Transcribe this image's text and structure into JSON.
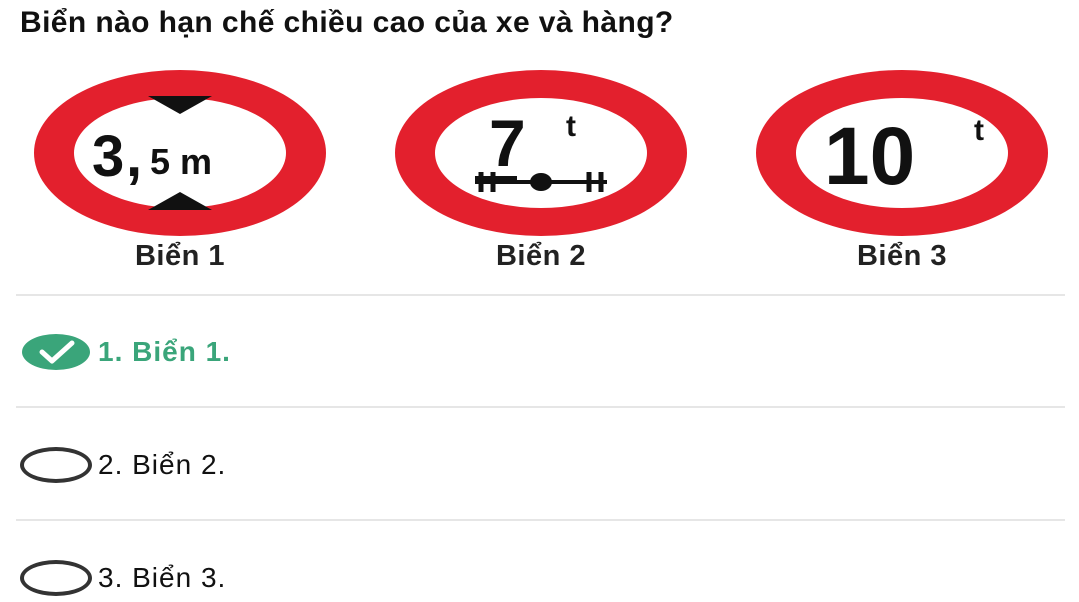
{
  "question": "Biển nào hạn chế chiều cao của xe và hàng?",
  "signs": [
    {
      "label": "Biển 1",
      "main": "3",
      "sep": ",",
      "minor": "5 m",
      "icon": "height-limit-sign"
    },
    {
      "label": "Biển 2",
      "main": "7",
      "sup": "t",
      "icon": "axle-load-limit-sign"
    },
    {
      "label": "Biển 3",
      "main": "10",
      "sup": "t",
      "icon": "weight-limit-sign"
    }
  ],
  "options": [
    {
      "text": "1. Biển 1.",
      "selected": true
    },
    {
      "text": "2. Biển 2.",
      "selected": false
    },
    {
      "text": "3. Biển 3.",
      "selected": false
    }
  ],
  "colors": {
    "sign_red": "#e3202d",
    "correct": "#3aa57a",
    "radio_border": "#333333"
  }
}
